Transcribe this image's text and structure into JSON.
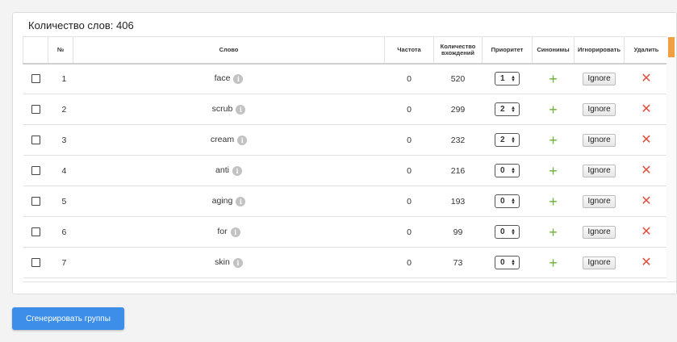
{
  "panel": {
    "title": "Количество слов: 406"
  },
  "table": {
    "headers": {
      "num": "№",
      "word": "Слово",
      "frequency": "Частота",
      "occurrences": "Количество вхождений",
      "priority": "Приоритет",
      "synonyms": "Синонимы",
      "ignore": "Игнорировать",
      "delete": "Удалить"
    },
    "rows": [
      {
        "num": "1",
        "word": "face",
        "frequency": "0",
        "occurrences": "520",
        "priority": "1"
      },
      {
        "num": "2",
        "word": "scrub",
        "frequency": "0",
        "occurrences": "299",
        "priority": "2"
      },
      {
        "num": "3",
        "word": "cream",
        "frequency": "0",
        "occurrences": "232",
        "priority": "2"
      },
      {
        "num": "4",
        "word": "anti",
        "frequency": "0",
        "occurrences": "216",
        "priority": "0"
      },
      {
        "num": "5",
        "word": "aging",
        "frequency": "0",
        "occurrences": "193",
        "priority": "0"
      },
      {
        "num": "6",
        "word": "for",
        "frequency": "0",
        "occurrences": "99",
        "priority": "0"
      },
      {
        "num": "7",
        "word": "skin",
        "frequency": "0",
        "occurrences": "73",
        "priority": "0"
      }
    ],
    "ignore_label": "Ignore",
    "icons": {
      "info": "info-icon",
      "add": "plus-icon",
      "delete": "close-icon"
    }
  },
  "actions": {
    "generate_label": "Сгенерировать группы"
  },
  "colors": {
    "primary_button": "#3c8ee8",
    "add_icon": "#6bb23a",
    "delete_icon": "#e05040",
    "scroll_thumb": "#f0a040"
  }
}
